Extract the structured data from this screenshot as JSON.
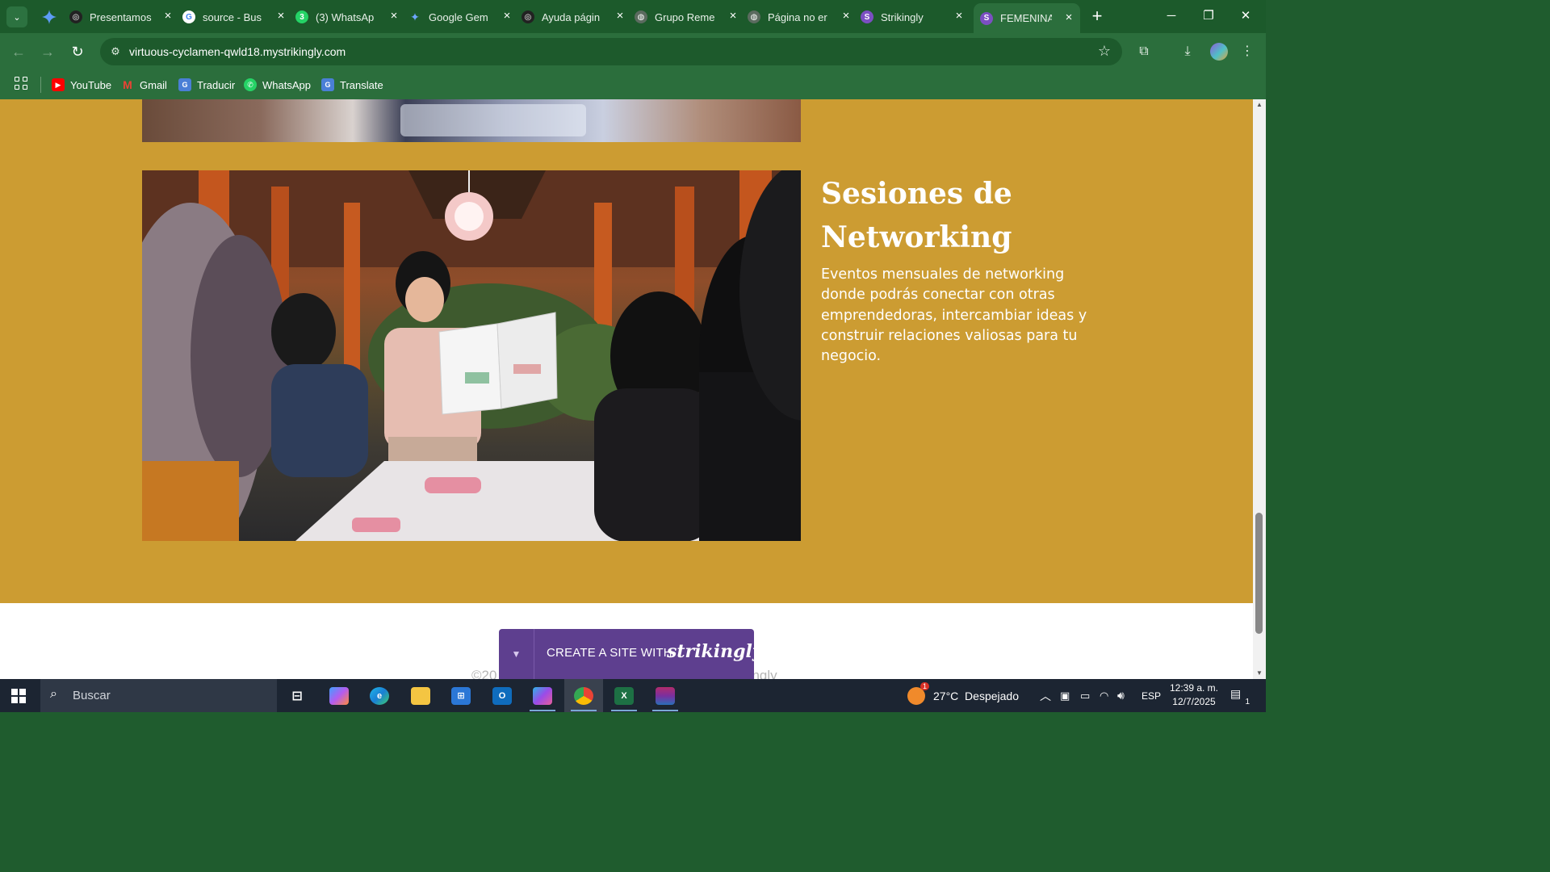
{
  "browser": {
    "tabs": [
      {
        "title": "Presentamos",
        "favicon": "openai-icon",
        "active": false
      },
      {
        "title": "source - Bus",
        "favicon": "google-icon",
        "active": false
      },
      {
        "title": "(3) WhatsAp",
        "favicon": "whatsapp-icon",
        "active": false
      },
      {
        "title": "Google Gem",
        "favicon": "gemini-icon",
        "active": false
      },
      {
        "title": "Ayuda págin",
        "favicon": "openai-icon",
        "active": false
      },
      {
        "title": "Grupo Reme",
        "favicon": "globe-icon",
        "active": false
      },
      {
        "title": "Página no er",
        "favicon": "globe-icon",
        "active": false
      },
      {
        "title": "Strikingly",
        "favicon": "strikingly-icon",
        "active": false
      },
      {
        "title": "FEMENINAS",
        "favicon": "strikingly-icon",
        "active": true
      }
    ],
    "url": "virtuous-cyclamen-qwld18.mystrikingly.com",
    "bookmarks": [
      {
        "label": "YouTube",
        "icon": "youtube-icon"
      },
      {
        "label": "Gmail",
        "icon": "gmail-icon"
      },
      {
        "label": "Traducir",
        "icon": "translate-icon"
      },
      {
        "label": "WhatsApp",
        "icon": "whatsapp-icon"
      },
      {
        "label": "Translate",
        "icon": "translate-icon"
      }
    ]
  },
  "page": {
    "section_title": "Sesiones de Networking",
    "section_description": "Eventos mensuales de networking donde podrás conectar con otras emprendedoras, intercambiar ideas y construir relaciones valiosas para tu negocio.",
    "copyright_partial": "©20",
    "copyright_tail": "ngly",
    "promo": {
      "text": "CREATE A SITE WITH",
      "brand": "strikingly"
    },
    "colors": {
      "section_background": "#cc9c32",
      "promo_background": "#5e3f8f"
    }
  },
  "taskbar": {
    "search_placeholder": "Buscar",
    "weather_badge": "1",
    "weather": "27°C  Despejado",
    "language": "ESP",
    "time": "12:39 a. m.",
    "date": "12/7/2025",
    "notification_count": "1"
  }
}
